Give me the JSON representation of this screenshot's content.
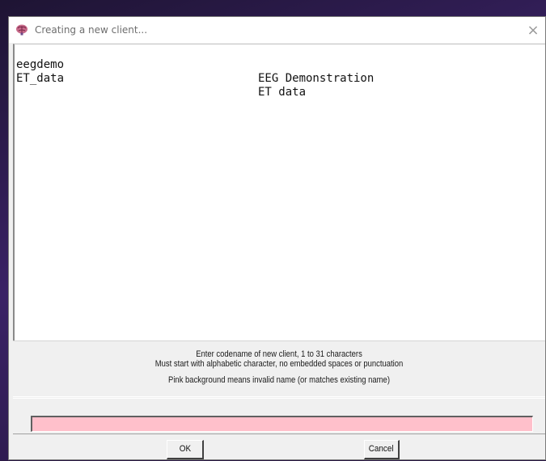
{
  "window": {
    "title": "Creating a new client...",
    "close_glyph": "×",
    "icon": "brain-icon"
  },
  "client_list": [
    {
      "code": "eegdemo",
      "description": "EEG Demonstration"
    },
    {
      "code": "ET_data",
      "description": "ET data"
    }
  ],
  "instructions": {
    "line1": "Enter codename of new client, 1 to 31 characters",
    "line2": "Must start with alphabetic character, no embedded spaces or punctuation",
    "line3": "Pink background means invalid name (or matches existing name)"
  },
  "name_input": {
    "value": "",
    "background": "#ffc0cb",
    "state": "invalid"
  },
  "buttons": {
    "ok_label": "OK",
    "cancel_label": "Cancel"
  }
}
